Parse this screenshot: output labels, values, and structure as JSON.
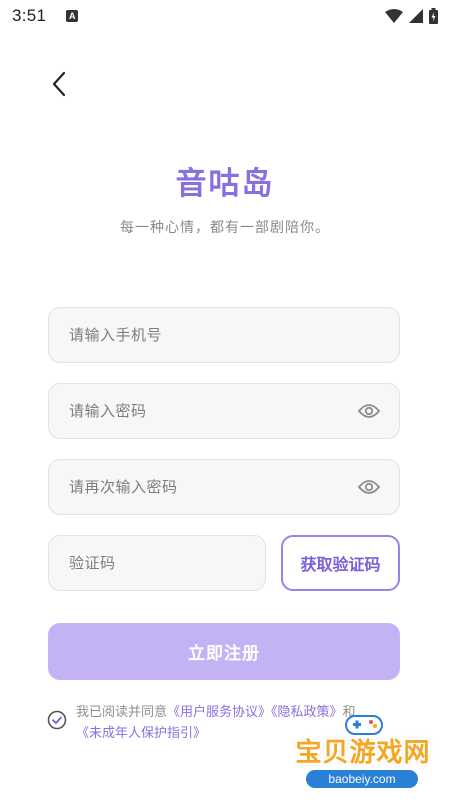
{
  "status_bar": {
    "time": "3:51",
    "notification_letter": "A"
  },
  "app": {
    "title": "音咕岛",
    "subtitle": "每一种心情，都有一部剧陪你。"
  },
  "form": {
    "phone_placeholder": "请输入手机号",
    "password_placeholder": "请输入密码",
    "confirm_password_placeholder": "请再次输入密码",
    "code_placeholder": "验证码",
    "get_code_label": "获取验证码",
    "register_label": "立即注册"
  },
  "agreement": {
    "prefix": "我已阅读并同意",
    "user_agreement": "《用户服务协议》",
    "privacy_policy": "《隐私政策》",
    "and": "和",
    "minor_guide": "《未成年人保护指引》"
  },
  "watermark": {
    "brand": "宝贝游戏网",
    "url": "baobeiy.com"
  },
  "colors": {
    "accent": "#8a6fe0",
    "button_disabled": "#c3b3f4",
    "field_bg": "#f7f7f7"
  },
  "icons": [
    "back-arrow-icon",
    "eye-icon",
    "check-circle-icon",
    "wifi-icon",
    "signal-icon",
    "battery-icon"
  ]
}
